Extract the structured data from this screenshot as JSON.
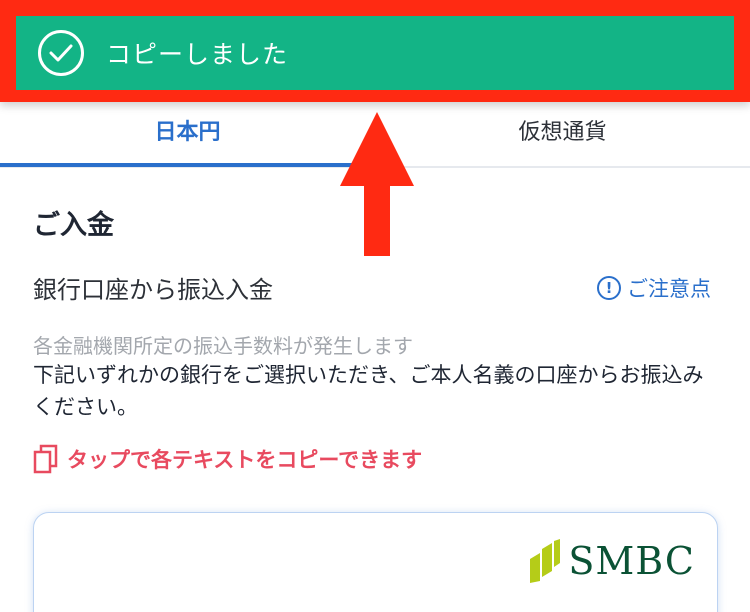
{
  "toast": {
    "message": "コピーしました"
  },
  "tabs": [
    {
      "label": "日本円",
      "active": true
    },
    {
      "label": "仮想通貨",
      "active": false
    }
  ],
  "content": {
    "heading": "ご入金",
    "bank_transfer_title": "銀行口座から振込入金",
    "notice_link": "ご注意点",
    "fee_note": "各金融機関所定の振込手数料が発生します",
    "instruction": "下記いずれかの銀行をご選択いただき、ご本人名義の口座からお振込みください。",
    "copy_hint": "タップで各テキストをコピーできます"
  },
  "bank_card": {
    "name": "SMBC"
  },
  "colors": {
    "toast_bg": "#13b486",
    "highlight_border": "#ff2a12",
    "accent_blue": "#2a6fcb",
    "copy_hint_red": "#e84a5f",
    "smbc_green": "#0b5235",
    "smbc_lime": "#b5cc18"
  },
  "icons": {
    "toast": "check-circle-icon",
    "notice": "exclamation-circle-icon",
    "copy": "copy-icon",
    "arrow": "up-arrow-icon"
  }
}
